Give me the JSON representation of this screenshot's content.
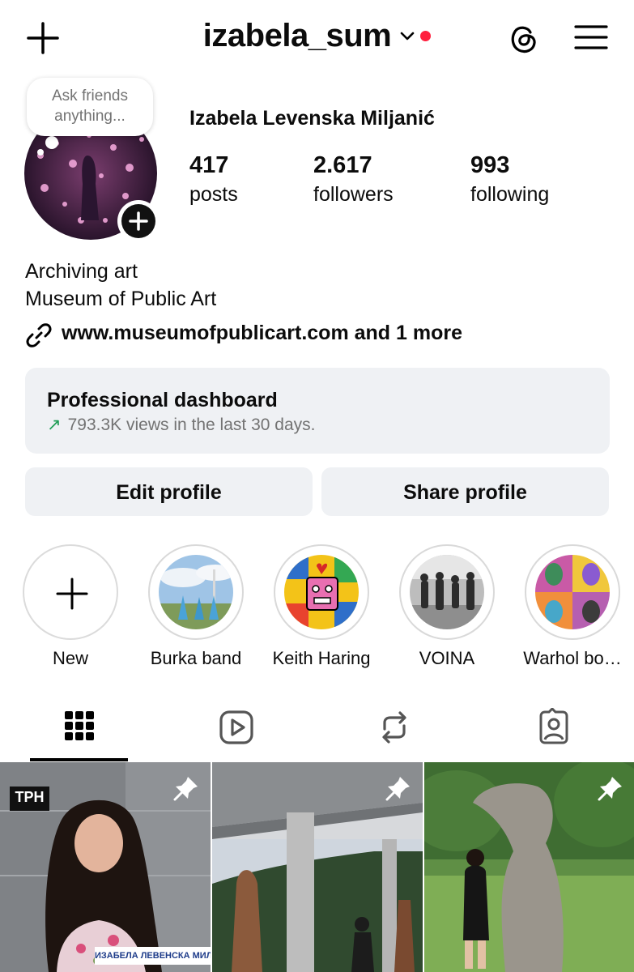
{
  "header": {
    "username": "izabela_sum",
    "icons": [
      "plus-icon",
      "chevron-down-icon",
      "notification-dot",
      "threads-icon",
      "menu-icon"
    ],
    "accent_dot_color": "#ff1f3d"
  },
  "profile": {
    "note_bubble": "Ask friends anything...",
    "full_name": "Izabela Levenska Miljanić",
    "stats": [
      {
        "value": "417",
        "label": "posts"
      },
      {
        "value": "2.617",
        "label": "followers"
      },
      {
        "value": "993",
        "label": "following"
      }
    ],
    "bio_lines": [
      "Archiving art",
      "Museum of Public Art"
    ],
    "link": "www.museumofpublicart.com and 1 more"
  },
  "dashboard": {
    "title": "Professional dashboard",
    "subtitle": "793.3K views in the last 30 days.",
    "trend_icon": "trending-up-arrow",
    "trend_color": "#1f9d55"
  },
  "buttons": {
    "edit": "Edit profile",
    "share": "Share profile"
  },
  "highlights": [
    {
      "label": "New"
    },
    {
      "label": "Burka band"
    },
    {
      "label": "Keith Haring"
    },
    {
      "label": "VOINA"
    },
    {
      "label": "Warhol bo…"
    }
  ],
  "tabs": [
    "grid-icon",
    "reels-icon",
    "reposts-icon",
    "tagged-icon"
  ],
  "posts": [
    {
      "badge": "TPH",
      "caption": "ИЗАБЕЛА ЛЕВЕНСКА МИЉАНИ",
      "pinned": true
    },
    {
      "pinned": true
    },
    {
      "pinned": true
    }
  ]
}
